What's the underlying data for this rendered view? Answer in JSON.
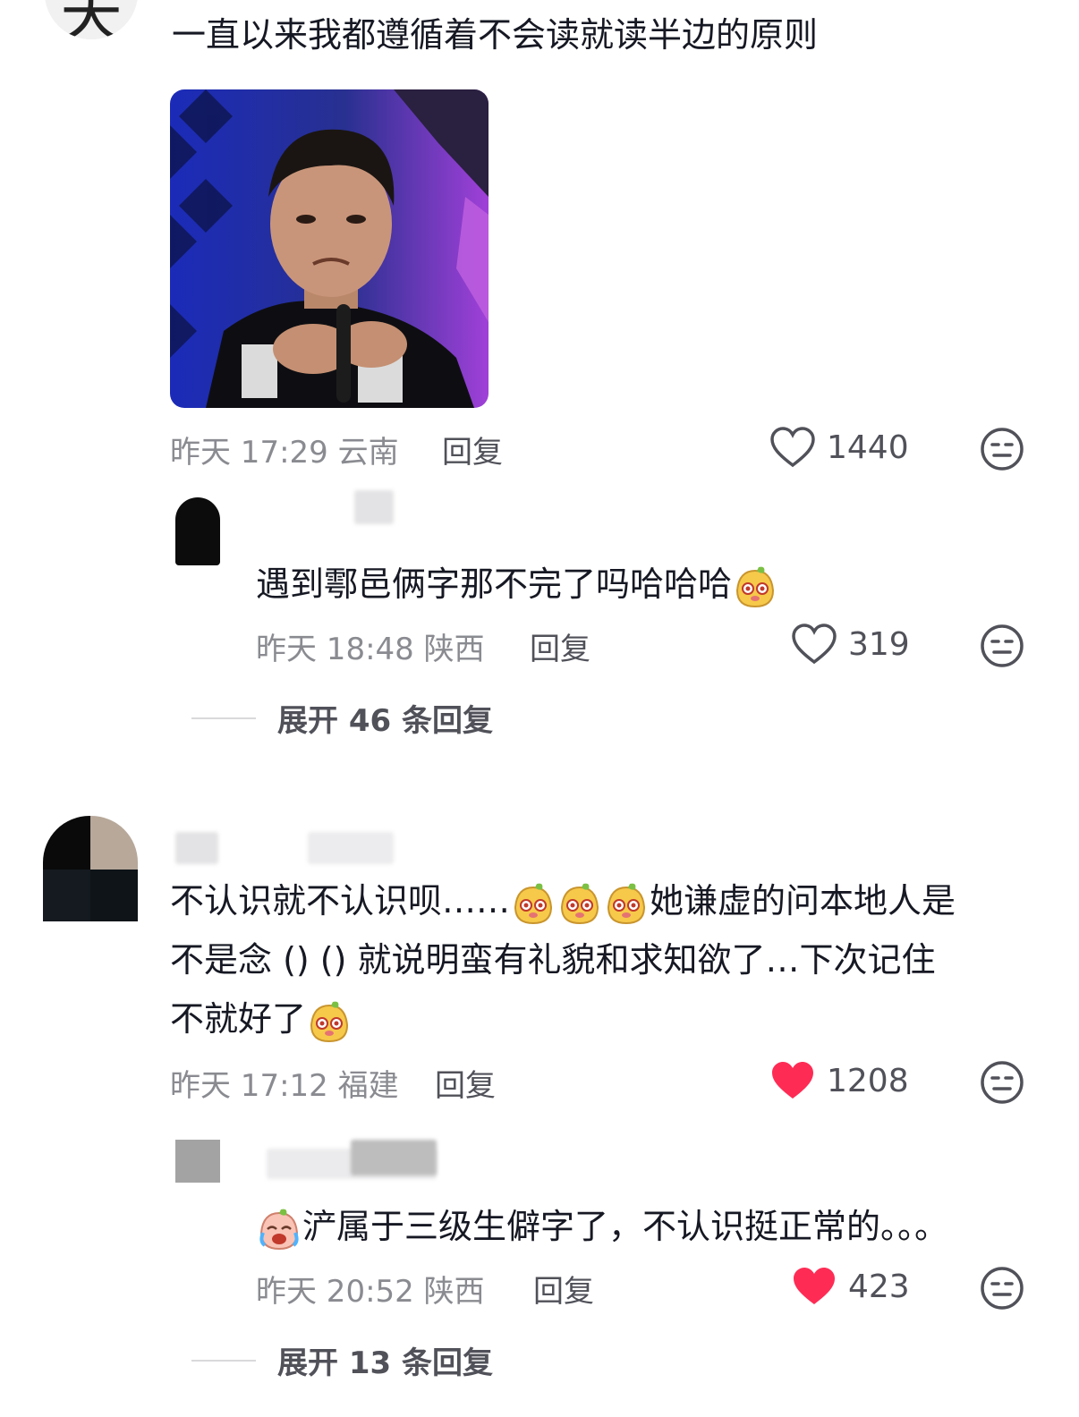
{
  "comment1": {
    "text": "一直以来我都遵循着不会读就读半边的原则",
    "time": "昨天 17:29",
    "location": "云南",
    "reply_label": "回复",
    "likes": "1440",
    "liked": false,
    "reply1": {
      "text": "遇到鄠邑俩字那不完了吗哈哈哈",
      "time": "昨天 18:48",
      "location": "陕西",
      "reply_label": "回复",
      "likes": "319",
      "liked": false
    },
    "expand_label": "展开 46 条回复"
  },
  "comment2": {
    "line1": "不认识就不认识呗……",
    "line1b": "她谦虚的问本地人是",
    "line2": "不是念 () () 就说明蛮有礼貌和求知欲了…下次记住",
    "line3": "不就好了",
    "time": "昨天 17:12",
    "location": "福建",
    "reply_label": "回复",
    "likes": "1208",
    "liked": true,
    "reply1": {
      "text": "浐属于三级生僻字了，不认识挺正常的。。。",
      "time": "昨天 20:52",
      "location": "陕西",
      "reply_label": "回复",
      "likes": "423",
      "liked": true
    },
    "expand_label": "展开 13 条回复"
  },
  "colors": {
    "like_red": "#fe2c55",
    "meta": "#8a8b91",
    "text": "#161823"
  }
}
